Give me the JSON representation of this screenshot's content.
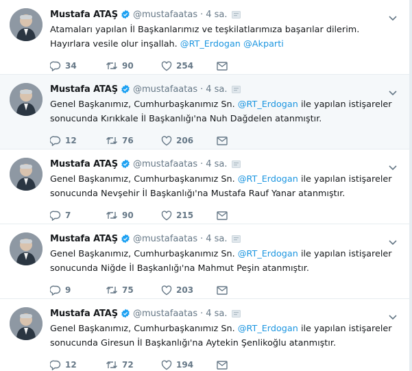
{
  "colors": {
    "link": "#1b95e0",
    "muted": "#657786",
    "verified": "#1da1f2"
  },
  "tweets": [
    {
      "name": "Mustafa ATAŞ",
      "handle": "@mustafaatas",
      "dot": "·",
      "time": "4 sa.",
      "line1": "Atamaları yapılan İl Başkanlarımız ve teşkilatlarımıza başarılar dilerim.",
      "line2_text": "Hayırlara vesile olur inşallah. ",
      "line2_mention1": "@RT_Erdogan",
      "line2_sep": " ",
      "line2_mention2": "@Akparti",
      "replies": "34",
      "retweets": "90",
      "likes": "254"
    },
    {
      "name": "Mustafa ATAŞ",
      "handle": "@mustafaatas",
      "dot": "·",
      "time": "4 sa.",
      "line1_pre": "Genel Başkanımız, Cumhurbaşkanımız Sn. ",
      "line1_mention": "@RT_Erdogan",
      "line1_post": " ile yapılan istişareler",
      "line2": "sonucunda Kırıkkale İl Başkanlığı'na Nuh Dağdelen atanmıştır.",
      "replies": "12",
      "retweets": "76",
      "likes": "206"
    },
    {
      "name": "Mustafa ATAŞ",
      "handle": "@mustafaatas",
      "dot": "·",
      "time": "4 sa.",
      "line1_pre": "Genel Başkanımız, Cumhurbaşkanımız Sn. ",
      "line1_mention": "@RT_Erdogan",
      "line1_post": " ile yapılan istişareler",
      "line2": "sonucunda Nevşehir İl Başkanlığı'na Mustafa Rauf Yanar atanmıştır.",
      "replies": "7",
      "retweets": "90",
      "likes": "215"
    },
    {
      "name": "Mustafa ATAŞ",
      "handle": "@mustafaatas",
      "dot": "·",
      "time": "4 sa.",
      "line1_pre": "Genel Başkanımız, Cumhurbaşkanımız Sn. ",
      "line1_mention": "@RT_Erdogan",
      "line1_post": " ile yapılan istişareler",
      "line2": "sonucunda Niğde İl Başkanlığı'na Mahmut Peşin atanmıştır.",
      "replies": "9",
      "retweets": "75",
      "likes": "203"
    },
    {
      "name": "Mustafa ATAŞ",
      "handle": "@mustafaatas",
      "dot": "·",
      "time": "4 sa.",
      "line1_pre": "Genel Başkanımız, Cumhurbaşkanımız Sn. ",
      "line1_mention": "@RT_Erdogan",
      "line1_post": " ile yapılan istişareler",
      "line2": "sonucunda Giresun İl Başkanlığı'na Aytekin Şenlikoğlu atanmıştır.",
      "replies": "12",
      "retweets": "72",
      "likes": "194"
    }
  ]
}
